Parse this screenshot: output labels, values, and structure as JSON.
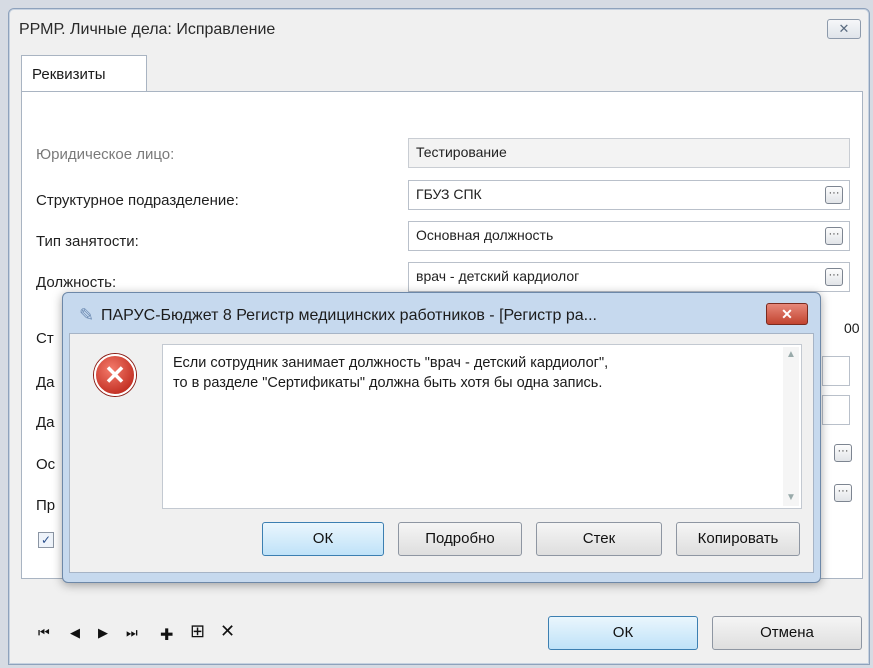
{
  "window": {
    "title": "РРМР. Личные дела: Исправление",
    "close_symbol": "✕"
  },
  "tab": {
    "label": "Реквизиты"
  },
  "form": {
    "legal_entity": {
      "label": "Юридическое лицо:",
      "value": "Тестирование"
    },
    "department": {
      "label": "Структурное подразделение:",
      "value": "ГБУЗ СПК"
    },
    "employment_type": {
      "label": "Тип занятости:",
      "value": "Основная должность"
    },
    "position": {
      "label": "Должность:",
      "value": "врач - детский кардиолог"
    },
    "partial_labels": [
      "Ст",
      "Да",
      "Да",
      "Ос",
      "Пр"
    ],
    "partial_value": "00"
  },
  "toolbar": {
    "first": "⏮",
    "prev": "◀",
    "next": "▶",
    "last": "⏭",
    "add": "✚",
    "add_box": "⊞",
    "delete": "✕",
    "ok_label": "ОК",
    "cancel_label": "Отмена"
  },
  "dialog": {
    "title": "ПАРУС-Бюджет 8 Регистр медицинских работников - [Регистр ра...",
    "message_line1": "Если сотрудник занимает должность \"врач - детский кардиолог\",",
    "message_line2": "то в разделе \"Сертификаты\" должна быть хотя бы одна запись.",
    "buttons": {
      "ok": "ОК",
      "details": "Подробно",
      "stack": "Стек",
      "copy": "Копировать"
    }
  }
}
